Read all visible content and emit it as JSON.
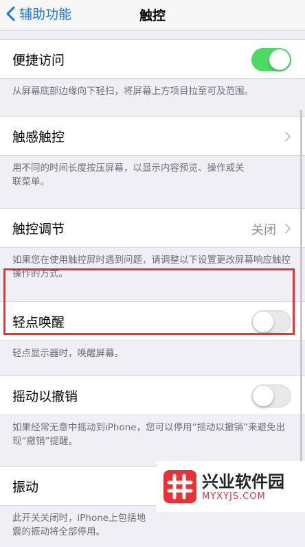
{
  "nav": {
    "back_label": "辅助功能",
    "title": "触控"
  },
  "rows": [
    {
      "label": "便捷访问",
      "control": "toggle",
      "state": "on",
      "footer": "从屏幕底部边缘向下轻扫，将屏幕上方项目拉至可及范围。"
    },
    {
      "label": "触感触控",
      "control": "chevron",
      "footer": "用不同的时间长度按压屏幕，以显示内容预览、操作或关联菜单。"
    },
    {
      "label": "触控调节",
      "control": "chevron",
      "value": "关闭",
      "footer": "如果您在使用触控屏时遇到问题，请调整以下设置更改屏幕响应触控操作的方式。"
    },
    {
      "label": "轻点唤醒",
      "control": "toggle",
      "state": "off",
      "footer": "轻点显示器时，唤醒屏幕。"
    },
    {
      "label": "摇动以撤销",
      "control": "toggle",
      "state": "off",
      "footer": "如果经常无意中摇动到iPhone，您可以停用“摇动以撤销”来避免出现“撤销”提醒。"
    },
    {
      "label": "振动",
      "control": "toggle",
      "state": "on",
      "footer": "此开关关闭时，iPhone上包括地震的振动将全部停用。"
    }
  ],
  "colors": {
    "accent": "#1a73e8",
    "toggle_on": "#4cd964",
    "highlight": "#e8323a"
  },
  "watermark": {
    "text_cn": "兴业软件园",
    "text_en": "MYXYJS.COM"
  }
}
